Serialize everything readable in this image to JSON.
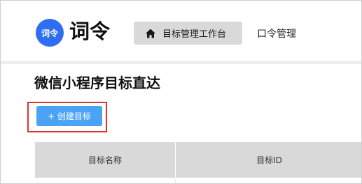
{
  "brand": {
    "logo_text": "词令",
    "name": "词令",
    "logo_color": "#2f6ef2"
  },
  "nav": {
    "items": [
      {
        "label": "目标管理工作台",
        "icon": "home-icon",
        "active": true
      },
      {
        "label": "口令管理",
        "active": false
      }
    ]
  },
  "page": {
    "title": "微信小程序目标直达"
  },
  "toolbar": {
    "create_label": "+ 创建目标",
    "create_color": "#4aa3f5",
    "highlight_color": "#e03131"
  },
  "table": {
    "columns": [
      "目标名称",
      "目标ID"
    ]
  }
}
